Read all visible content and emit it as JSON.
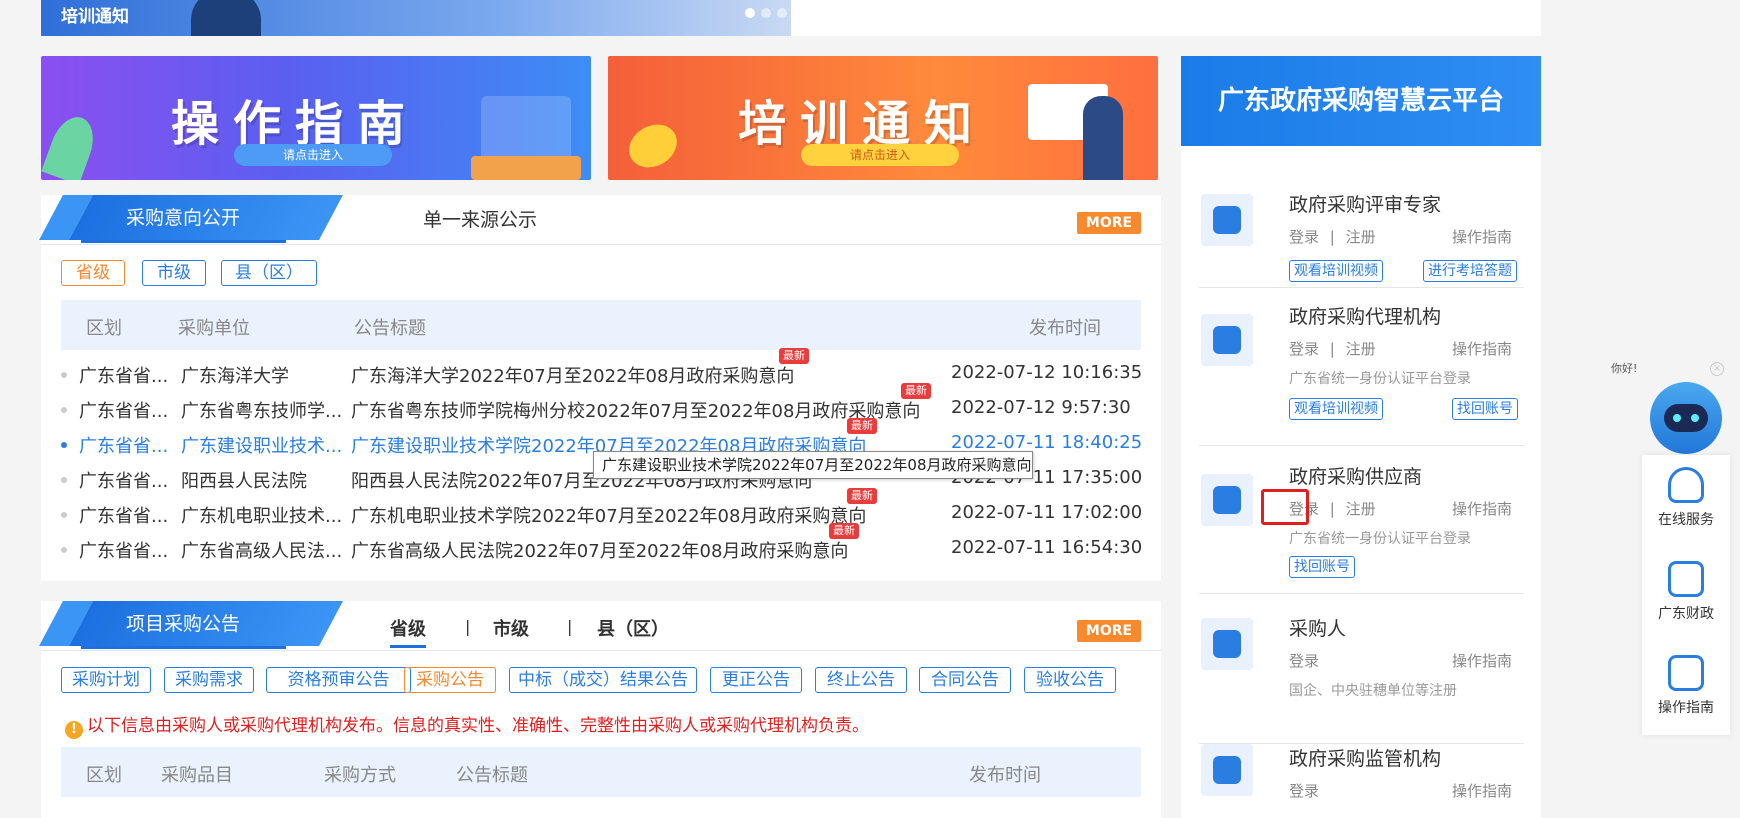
{
  "top_banner": {
    "title": "培训通知"
  },
  "banners": {
    "guide": {
      "title": "操作指南",
      "enter": "请点击进入"
    },
    "training": {
      "title": "培训通知",
      "enter": "请点击进入"
    }
  },
  "intent_panel": {
    "active_tab": "采购意向公开",
    "other_tab": "单一来源公示",
    "more": "MORE",
    "filters": [
      "省级",
      "市级",
      "县（区）"
    ],
    "headers": {
      "region": "区划",
      "unit": "采购单位",
      "title": "公告标题",
      "time": "发布时间"
    },
    "new_label": "最新",
    "rows": [
      {
        "region": "广东省省...",
        "unit": "广东海洋大学",
        "title": "广东海洋大学2022年07月至2022年08月政府采购意向",
        "time": "2022-07-12 10:16:35"
      },
      {
        "region": "广东省省...",
        "unit": "广东省粤东技师学...",
        "title": "广东省粤东技师学院梅州分校2022年07月至2022年08月政府采购意向",
        "time": "2022-07-12 9:57:30"
      },
      {
        "region": "广东省省...",
        "unit": "广东建设职业技术...",
        "title": "广东建设职业技术学院2022年07月至2022年08月政府采购意向",
        "time": "2022-07-11 18:40:25"
      },
      {
        "region": "广东省省...",
        "unit": "阳西县人民法院",
        "title": "阳西县人民法院2022年07月至2022年08月政府采购意向",
        "time": "2022-07-11 17:35:00"
      },
      {
        "region": "广东省省...",
        "unit": "广东机电职业技术...",
        "title": "广东机电职业技术学院2022年07月至2022年08月政府采购意向",
        "time": "2022-07-11 17:02:00"
      },
      {
        "region": "广东省省...",
        "unit": "广东省高级人民法...",
        "title": "广东省高级人民法院2022年07月至2022年08月政府采购意向",
        "time": "2022-07-11 16:54:30"
      }
    ],
    "tooltip": "广东建设职业技术学院2022年07月至2022年08月政府采购意向"
  },
  "project_panel": {
    "title": "项目采购公告",
    "level_tabs": [
      "省级",
      "市级",
      "县（区）"
    ],
    "more": "MORE",
    "categories": [
      "采购计划",
      "采购需求",
      "资格预审公告",
      "采购公告",
      "中标（成交）结果公告",
      "更正公告",
      "终止公告",
      "合同公告",
      "验收公告"
    ],
    "notice": "以下信息由采购人或采购代理机构发布。信息的真实性、准确性、完整性由采购人或采购代理机构负责。",
    "headers": {
      "region": "区划",
      "item": "采购品目",
      "method": "采购方式",
      "title": "公告标题",
      "time": "发布时间"
    }
  },
  "platform": {
    "title": "广东政府采购智慧云平台",
    "roles": [
      {
        "name": "政府采购评审专家",
        "login": "登录",
        "sep": "|",
        "register": "注册",
        "guide": "操作指南",
        "btn1": "观看培训视频",
        "btn2": "进行考培答题"
      },
      {
        "name": "政府采购代理机构",
        "login": "登录",
        "sep": "|",
        "register": "注册",
        "guide": "操作指南",
        "sub": "广东省统一身份认证平台登录",
        "btn1": "观看培训视频",
        "btn2": "找回账号"
      },
      {
        "name": "政府采购供应商",
        "login": "登录",
        "sep": "|",
        "register": "注册",
        "guide": "操作指南",
        "sub": "广东省统一身份认证平台登录",
        "btn1": "找回账号"
      },
      {
        "name": "采购人",
        "login": "登录",
        "guide": "操作指南",
        "sub": "国企、中央驻穗单位等注册"
      },
      {
        "name": "政府采购监管机构",
        "login": "登录",
        "guide": "操作指南"
      }
    ]
  },
  "side": {
    "greeting": "你好!",
    "close": "×",
    "items": [
      "在线服务",
      "广东财政",
      "操作指南"
    ]
  }
}
